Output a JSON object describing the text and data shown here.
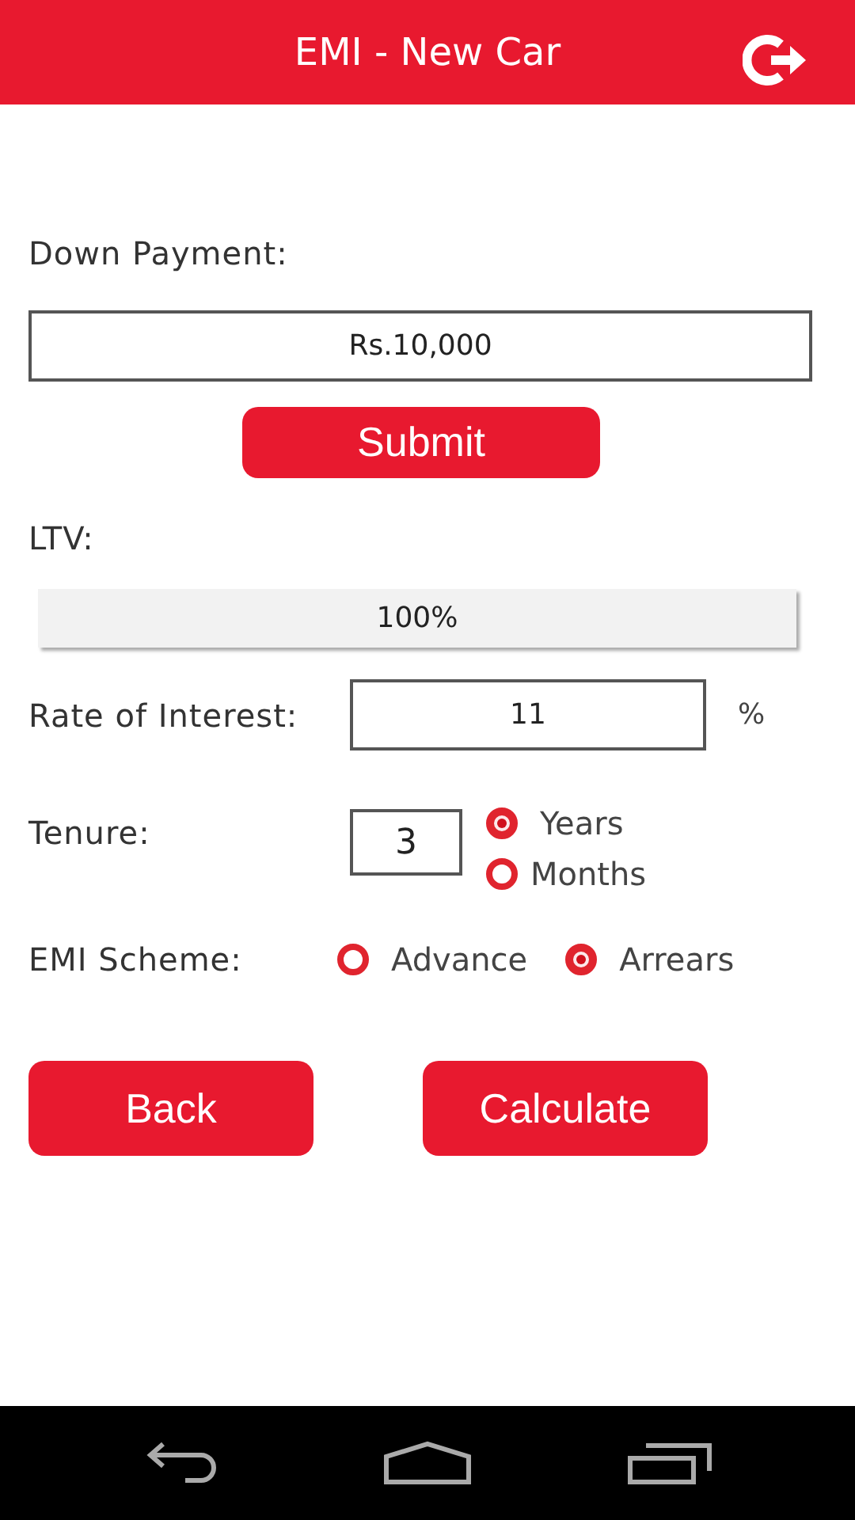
{
  "header": {
    "title": "EMI - New Car"
  },
  "down_payment": {
    "label": "Down Payment:",
    "value": "Rs.10,000"
  },
  "submit_button": "Submit",
  "ltv": {
    "label": "LTV:",
    "value": "100%"
  },
  "rate_of_interest": {
    "label": "Rate of Interest:",
    "value": "11",
    "unit": "%"
  },
  "tenure": {
    "label": "Tenure:",
    "value": "3",
    "options": [
      {
        "label": "Years",
        "selected": true
      },
      {
        "label": "Months",
        "selected": false
      }
    ]
  },
  "emi_scheme": {
    "label": "EMI Scheme:",
    "options": [
      {
        "label": "Advance",
        "selected": false
      },
      {
        "label": "Arrears",
        "selected": true
      }
    ]
  },
  "buttons": [
    "Back",
    "Calculate"
  ]
}
